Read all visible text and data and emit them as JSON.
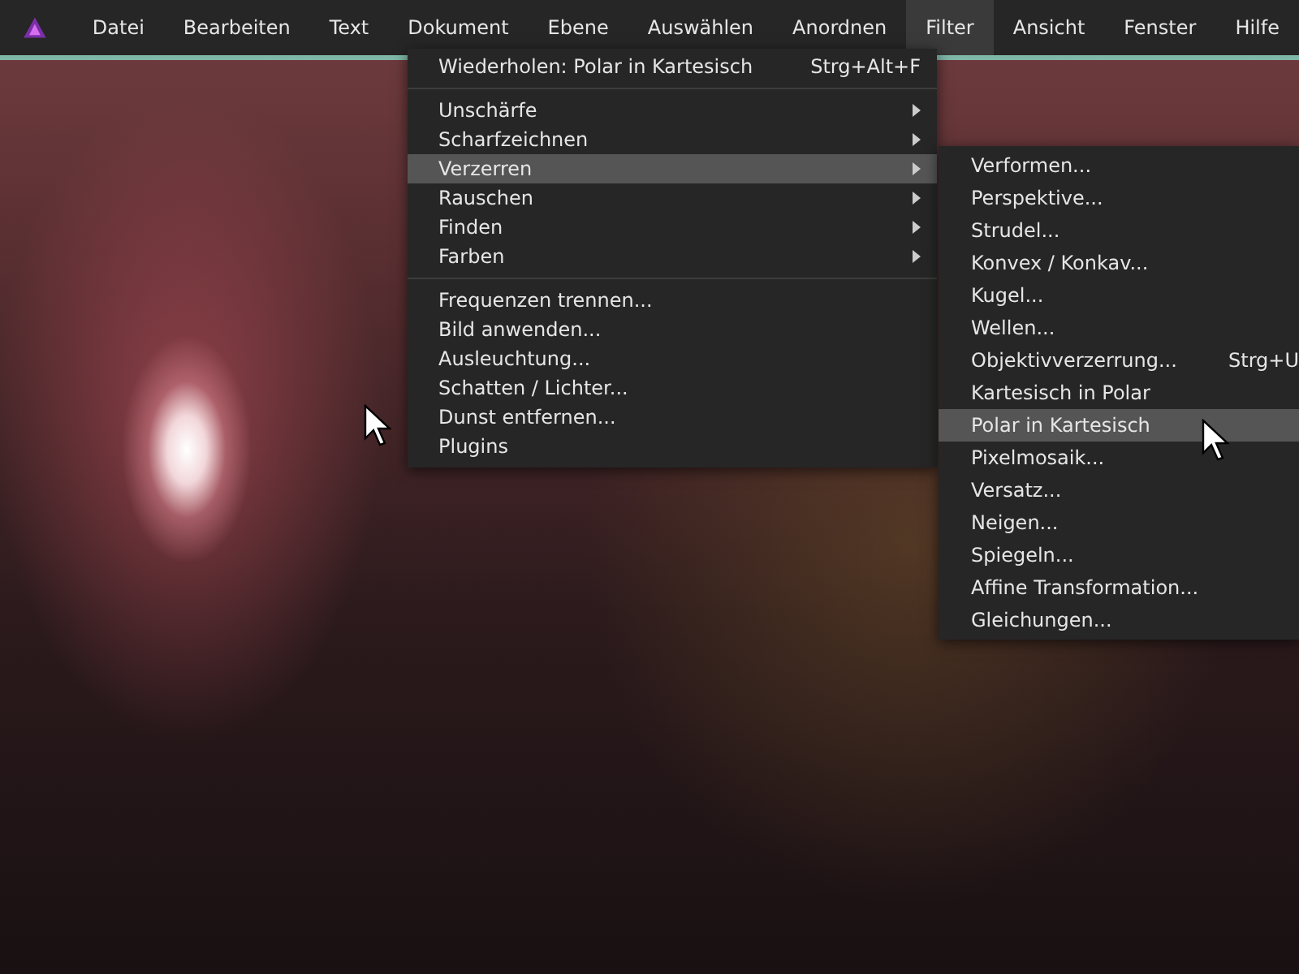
{
  "menu_bar": {
    "items": [
      {
        "label": "Datei",
        "selected": false
      },
      {
        "label": "Bearbeiten",
        "selected": false
      },
      {
        "label": "Text",
        "selected": false
      },
      {
        "label": "Dokument",
        "selected": false
      },
      {
        "label": "Ebene",
        "selected": false
      },
      {
        "label": "Auswählen",
        "selected": false
      },
      {
        "label": "Anordnen",
        "selected": false
      },
      {
        "label": "Filter",
        "selected": true
      },
      {
        "label": "Ansicht",
        "selected": false
      },
      {
        "label": "Fenster",
        "selected": false
      },
      {
        "label": "Hilfe",
        "selected": false
      }
    ]
  },
  "filter_menu": {
    "items": [
      {
        "kind": "command",
        "label": "Wiederholen: Polar in Kartesisch",
        "shortcut": "Strg+Alt+F",
        "selected": false
      },
      {
        "kind": "separator"
      },
      {
        "kind": "submenu",
        "label": "Unschärfe",
        "selected": false
      },
      {
        "kind": "submenu",
        "label": "Scharfzeichnen",
        "selected": false
      },
      {
        "kind": "submenu",
        "label": "Verzerren",
        "selected": true
      },
      {
        "kind": "submenu",
        "label": "Rauschen",
        "selected": false
      },
      {
        "kind": "submenu",
        "label": "Finden",
        "selected": false
      },
      {
        "kind": "submenu",
        "label": "Farben",
        "selected": false
      },
      {
        "kind": "separator"
      },
      {
        "kind": "command",
        "label": "Frequenzen trennen...",
        "selected": false
      },
      {
        "kind": "command",
        "label": "Bild anwenden...",
        "selected": false
      },
      {
        "kind": "command",
        "label": "Ausleuchtung...",
        "selected": false
      },
      {
        "kind": "command",
        "label": "Schatten / Lichter...",
        "selected": false
      },
      {
        "kind": "command",
        "label": "Dunst entfernen...",
        "selected": false
      },
      {
        "kind": "command",
        "label": "Plugins",
        "selected": false
      }
    ]
  },
  "distort_submenu": {
    "items": [
      {
        "label": "Verformen...",
        "selected": false
      },
      {
        "label": "Perspektive...",
        "selected": false
      },
      {
        "label": "Strudel...",
        "selected": false
      },
      {
        "label": "Konvex / Konkav...",
        "selected": false
      },
      {
        "label": "Kugel...",
        "selected": false
      },
      {
        "label": "Wellen...",
        "selected": false
      },
      {
        "label": "Objektivverzerrung...",
        "shortcut": "Strg+U",
        "selected": false
      },
      {
        "label": "Kartesisch in Polar",
        "selected": false
      },
      {
        "label": "Polar in Kartesisch",
        "selected": true
      },
      {
        "label": "Pixelmosaik...",
        "selected": false
      },
      {
        "label": "Versatz...",
        "selected": false
      },
      {
        "label": "Neigen...",
        "selected": false
      },
      {
        "label": "Spiegeln...",
        "selected": false
      },
      {
        "label": "Affine Transformation...",
        "selected": false
      },
      {
        "label": "Gleichungen...",
        "selected": false
      }
    ]
  }
}
